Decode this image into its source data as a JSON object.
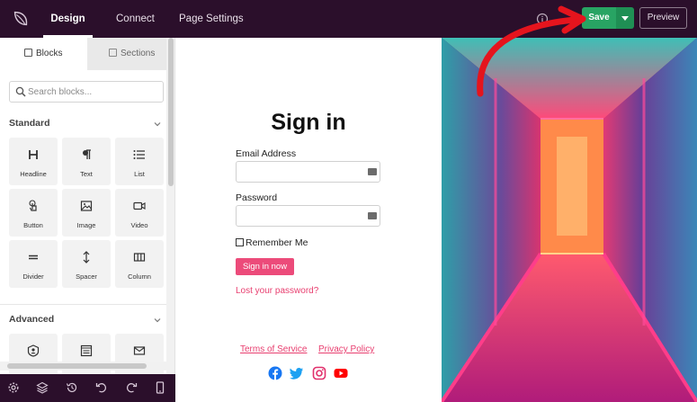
{
  "topbar": {
    "logo": "seedprod-leaf-logo",
    "tabs": [
      {
        "label": "Design",
        "active": true
      },
      {
        "label": "Connect",
        "active": false
      },
      {
        "label": "Page Settings",
        "active": false
      }
    ],
    "save_label": "Save",
    "preview_label": "Preview",
    "accent_color": "#28a463"
  },
  "sidebar": {
    "tabs": [
      {
        "label": "Blocks",
        "icon": "blocks-icon",
        "active": true
      },
      {
        "label": "Sections",
        "icon": "sections-icon",
        "active": false
      }
    ],
    "search_placeholder": "Search blocks...",
    "standard_label": "Standard",
    "standard_blocks": [
      {
        "label": "Headline",
        "icon": "headline-icon"
      },
      {
        "label": "Text",
        "icon": "paragraph-icon"
      },
      {
        "label": "List",
        "icon": "list-icon"
      },
      {
        "label": "Button",
        "icon": "pointer-icon"
      },
      {
        "label": "Image",
        "icon": "image-icon"
      },
      {
        "label": "Video",
        "icon": "video-icon"
      },
      {
        "label": "Divider",
        "icon": "divider-icon"
      },
      {
        "label": "Spacer",
        "icon": "spacer-icon"
      },
      {
        "label": "Column",
        "icon": "column-icon"
      }
    ],
    "advanced_label": "Advanced",
    "advanced_blocks": [
      {
        "label": "",
        "icon": "shield-user-icon"
      },
      {
        "label": "",
        "icon": "form-icon"
      },
      {
        "label": "",
        "icon": "envelope-icon"
      }
    ]
  },
  "bottombar": {
    "icons": [
      "gear-icon",
      "layers-icon",
      "history-icon",
      "undo-icon",
      "redo-icon",
      "mobile-icon"
    ]
  },
  "canvas": {
    "title": "Sign in",
    "email_label": "Email Address",
    "password_label": "Password",
    "remember_label": "Remember Me",
    "signin_label": "Sign in now",
    "lost_password": "Lost your password?",
    "terms_label": "Terms of Service",
    "privacy_label": "Privacy Policy",
    "social_icons": [
      "facebook-icon",
      "twitter-icon",
      "instagram-icon",
      "youtube-icon"
    ],
    "accent_color": "#ec4b7a"
  }
}
